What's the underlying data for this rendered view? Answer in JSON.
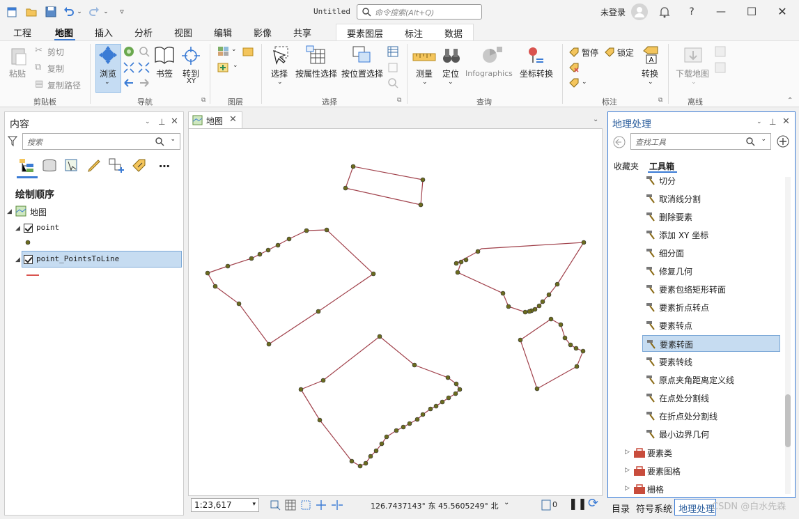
{
  "titlebar": {
    "document_title": "Untitled",
    "command_search_placeholder": "命令搜索(Alt+Q)",
    "user_status": "未登录"
  },
  "menu_tabs": [
    {
      "label": "工程",
      "active": false
    },
    {
      "label": "地图",
      "active": true
    },
    {
      "label": "插入",
      "active": false
    },
    {
      "label": "分析",
      "active": false
    },
    {
      "label": "视图",
      "active": false
    },
    {
      "label": "编辑",
      "active": false
    },
    {
      "label": "影像",
      "active": false
    },
    {
      "label": "共享",
      "active": false
    }
  ],
  "context_tabs": [
    "要素图层",
    "标注",
    "数据"
  ],
  "ribbon": {
    "clipboard": {
      "paste": "粘贴",
      "cut": "剪切",
      "copy": "复制",
      "copy_path": "复制路径",
      "group": "剪贴板"
    },
    "navigate": {
      "browse": "浏览",
      "bookmarks": "书签",
      "goto_xy": "转到\nXY",
      "group": "导航"
    },
    "layer": {
      "group": "图层"
    },
    "selection": {
      "select": "选择",
      "select_by_attributes": "按属性选择",
      "select_by_location": "按位置选择",
      "group": "选择"
    },
    "inquiry": {
      "measure": "测量",
      "locate": "定位",
      "infographics": "Infographics",
      "convert_coordinates": "坐标转换",
      "group": "查询"
    },
    "labeling": {
      "pause": "暂停",
      "lock": "锁定",
      "convert": "转换",
      "group": "标注"
    },
    "offline": {
      "download_map": "下载地图",
      "group": "离线"
    }
  },
  "contents": {
    "title": "内容",
    "search_placeholder": "搜索",
    "drawing_order": "绘制顺序",
    "map_name": "地图",
    "layers": [
      {
        "name": "point",
        "checked": true,
        "selected": false
      },
      {
        "name": "point_PointsToLine",
        "checked": true,
        "selected": true
      }
    ]
  },
  "map_view": {
    "tab_label": "地图",
    "scale": "1:23,617",
    "coordinates": "126.7437143° 东  45.5605249° 北",
    "selected_count": "0"
  },
  "geoprocessing": {
    "title": "地理处理",
    "search_placeholder": "查找工具",
    "tabs": [
      "收藏夹",
      "工具箱"
    ],
    "active_tab": "工具箱",
    "tools": [
      {
        "label": "切分",
        "selected": false
      },
      {
        "label": "取消线分割",
        "selected": false
      },
      {
        "label": "删除要素",
        "selected": false
      },
      {
        "label": "添加 XY 坐标",
        "selected": false
      },
      {
        "label": "细分面",
        "selected": false
      },
      {
        "label": "修复几何",
        "selected": false
      },
      {
        "label": "要素包络矩形转面",
        "selected": false
      },
      {
        "label": "要素折点转点",
        "selected": false
      },
      {
        "label": "要素转点",
        "selected": false
      },
      {
        "label": "要素转面",
        "selected": true
      },
      {
        "label": "要素转线",
        "selected": false
      },
      {
        "label": "原点夹角距离定义线",
        "selected": false
      },
      {
        "label": "在点处分割线",
        "selected": false
      },
      {
        "label": "在折点处分割线",
        "selected": false
      },
      {
        "label": "最小边界几何",
        "selected": false
      }
    ],
    "toolsets": [
      "要素类",
      "要素图格",
      "栅格"
    ]
  },
  "bottom_tabs": [
    "目录",
    "符号系统",
    "地理处理"
  ],
  "bottom_active_tab": "地理处理",
  "watermark": "CSDN @白水先森",
  "colors": {
    "accent": "#3a7bd5",
    "selection": "#c6dcf1",
    "line": "#a0404a",
    "point": "#6b6b1e"
  }
}
